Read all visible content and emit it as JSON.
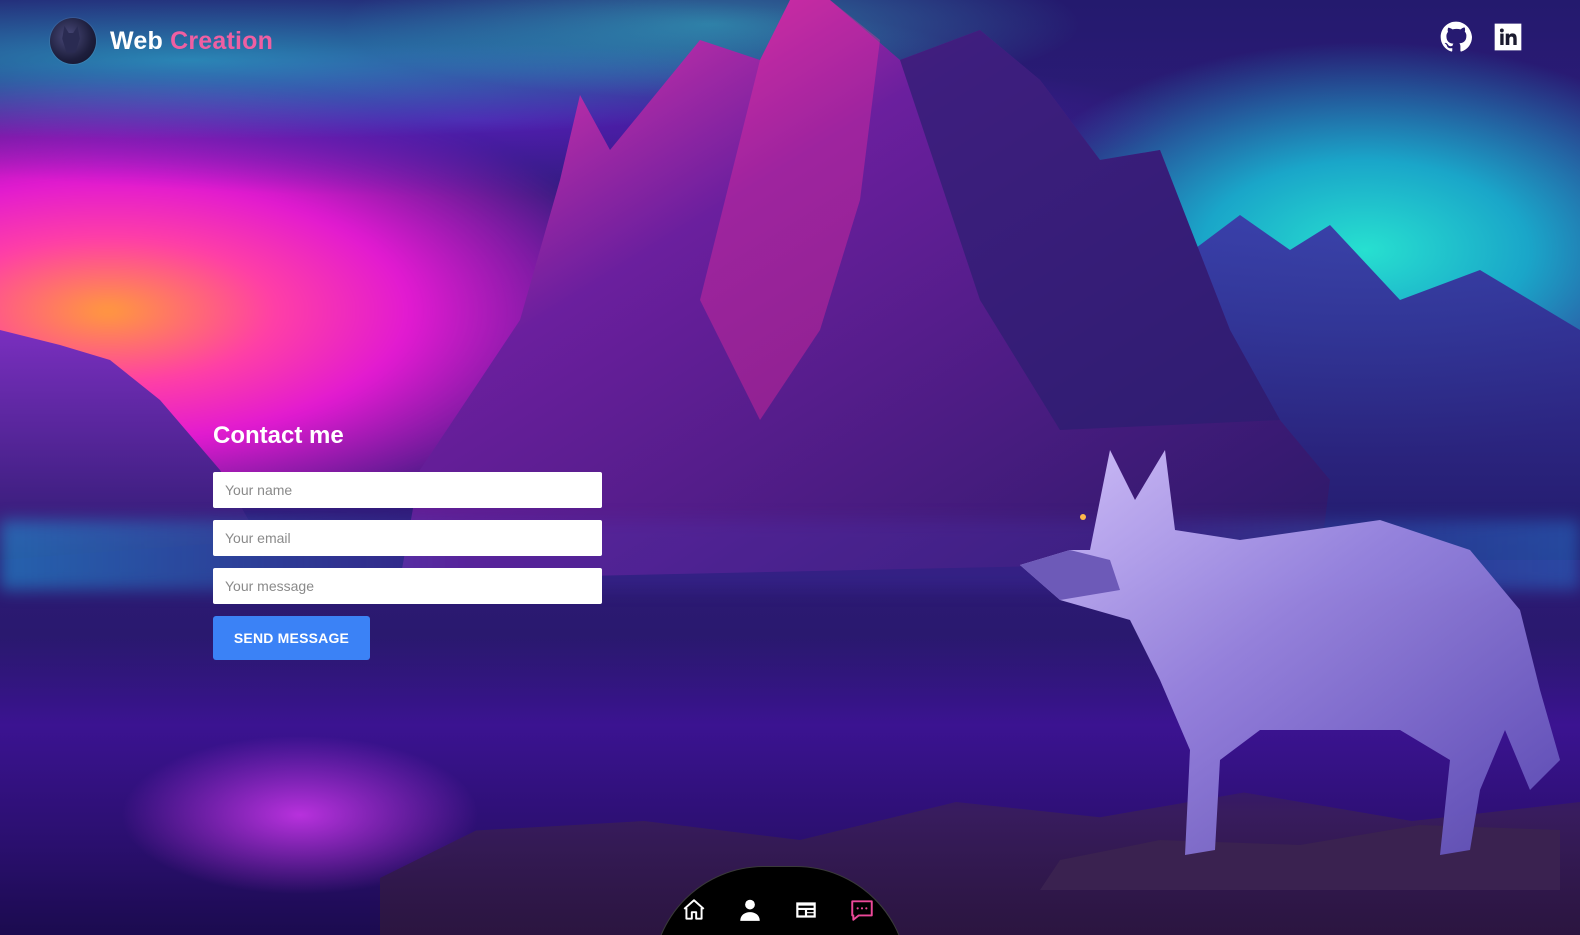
{
  "header": {
    "brand_word1": "Web",
    "brand_word2": "Creation",
    "logo": "wolf-logo",
    "socials": [
      {
        "icon": "github-icon"
      },
      {
        "icon": "linkedin-icon"
      }
    ]
  },
  "contact": {
    "title": "Contact me",
    "name_placeholder": "Your name",
    "email_placeholder": "Your email",
    "message_placeholder": "Your message",
    "submit_label": "SEND MESSAGE"
  },
  "bottom_nav": {
    "items": [
      {
        "icon": "home-icon",
        "active": false
      },
      {
        "icon": "user-icon",
        "active": false
      },
      {
        "icon": "projects-icon",
        "active": false
      },
      {
        "icon": "chat-icon",
        "active": true
      }
    ]
  },
  "colors": {
    "accent_pink": "#ef5fa2",
    "button_blue": "#3b82f6",
    "nav_background": "#000000",
    "nav_active": "#ec4899"
  }
}
